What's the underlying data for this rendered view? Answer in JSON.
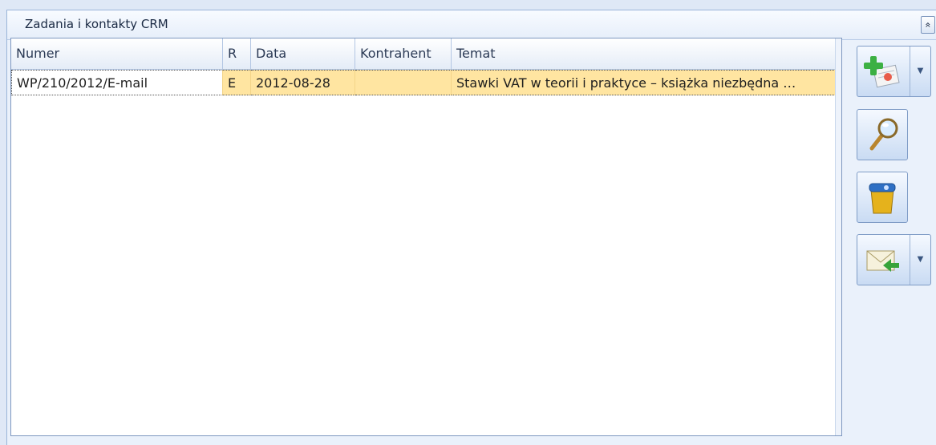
{
  "panel": {
    "title": "Zadania i kontakty CRM",
    "collapse_glyph": "»"
  },
  "grid": {
    "columns": [
      "Numer",
      "R",
      "Data",
      "Kontrahent",
      "Temat"
    ],
    "rows": [
      {
        "numer": "WP/210/2012/E-mail",
        "r": "E",
        "data": "2012-08-28",
        "kontrahent": "",
        "temat": "Stawki VAT w teorii i praktyce – książka niezbędna …"
      }
    ]
  },
  "toolbar": {
    "buttons": [
      {
        "icon": "add-task-icon",
        "has_dropdown": true
      },
      {
        "icon": "magnifier-icon",
        "has_dropdown": false
      },
      {
        "icon": "trash-icon",
        "has_dropdown": false
      },
      {
        "icon": "mail-incoming-icon",
        "has_dropdown": true
      }
    ],
    "dropdown_glyph": "▼"
  },
  "colors": {
    "selected_row": "#ffe5a1",
    "panel_bg": "#eaf1fb",
    "border": "#7e98c0"
  }
}
